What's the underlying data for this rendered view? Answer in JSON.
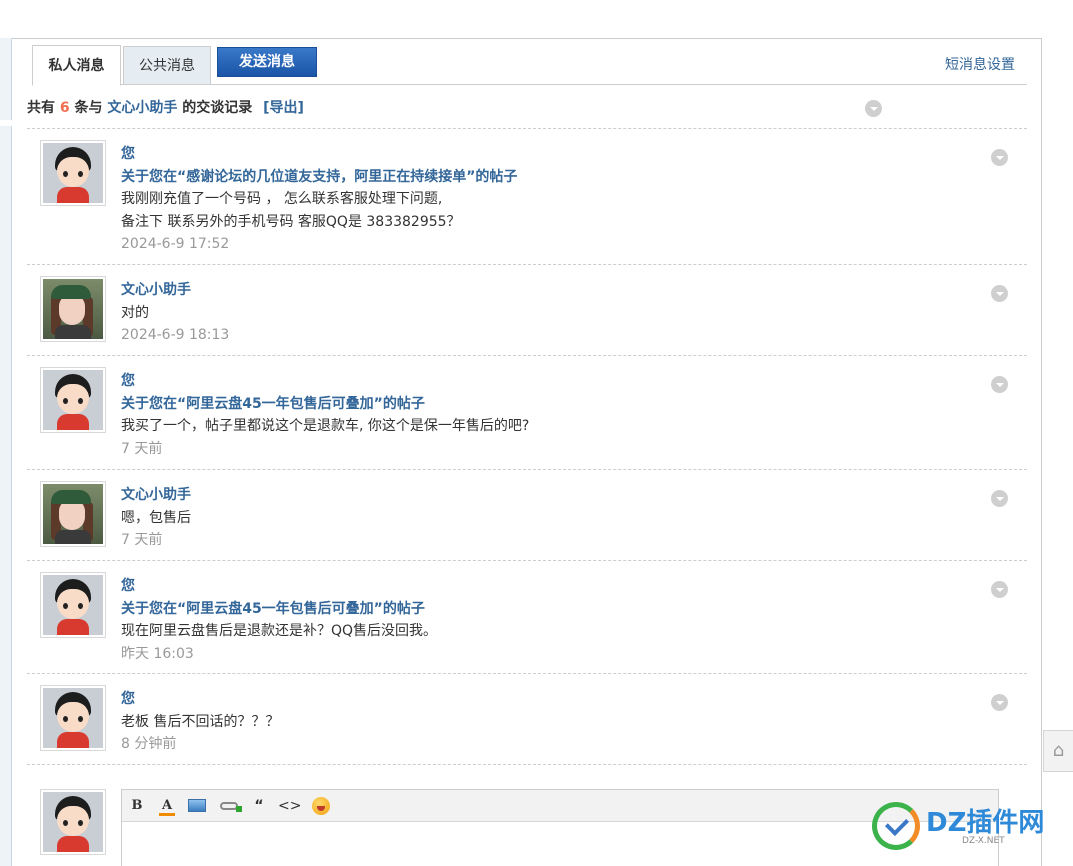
{
  "tabs": {
    "private": "私人消息",
    "public": "公共消息",
    "send": "发送消息",
    "settings": "短消息设置"
  },
  "summary": {
    "prefix": "共有",
    "count": "6",
    "mid": "条与",
    "partner": "文心小助手",
    "suffix": "的交谈记录",
    "export": "[导出]"
  },
  "messages": [
    {
      "author": "您",
      "subject": "关于您在“感谢论坛的几位道友支持，阿里正在持续接单”的帖子",
      "lines": [
        "我刚刚充值了一个号码 ， 怎么联系客服处理下问题,",
        "备注下 联系另外的手机号码  客服QQ是 383382955？"
      ],
      "time": "2024-6-9 17:52",
      "avatar": "boy-avatar"
    },
    {
      "author": "文心小助手",
      "lines": [
        "对的"
      ],
      "time": "2024-6-9 18:13",
      "avatar": "girl-avatar"
    },
    {
      "author": "您",
      "subject": "关于您在“阿里云盘45一年包售后可叠加”的帖子",
      "lines": [
        "我买了一个，帖子里都说这个是退款车, 你这个是保一年售后的吧?"
      ],
      "time": "7 天前",
      "avatar": "boy-avatar"
    },
    {
      "author": "文心小助手",
      "lines": [
        "嗯，包售后"
      ],
      "time": "7 天前",
      "avatar": "girl-avatar"
    },
    {
      "author": "您",
      "subject": "关于您在“阿里云盘45一年包售后可叠加”的帖子",
      "lines": [
        "现在阿里云盘售后是退款还是补？QQ售后没回我。"
      ],
      "time": "昨天 16:03",
      "avatar": "boy-avatar"
    },
    {
      "author": "您",
      "lines": [
        "老板 售后不回话的？？？"
      ],
      "time": "8 分钟前",
      "avatar": "boy-avatar"
    }
  ],
  "editor": {
    "bold": "B",
    "color": "A",
    "quote": "“",
    "code": "<>"
  },
  "watermark": {
    "brand": "DZ插件网",
    "sub": "DZ-X.NET"
  },
  "colors": {
    "link": "#336699",
    "count": "#f26c4f",
    "send_button": "#1a55a8",
    "tab_inactive": "#e5edf2"
  }
}
